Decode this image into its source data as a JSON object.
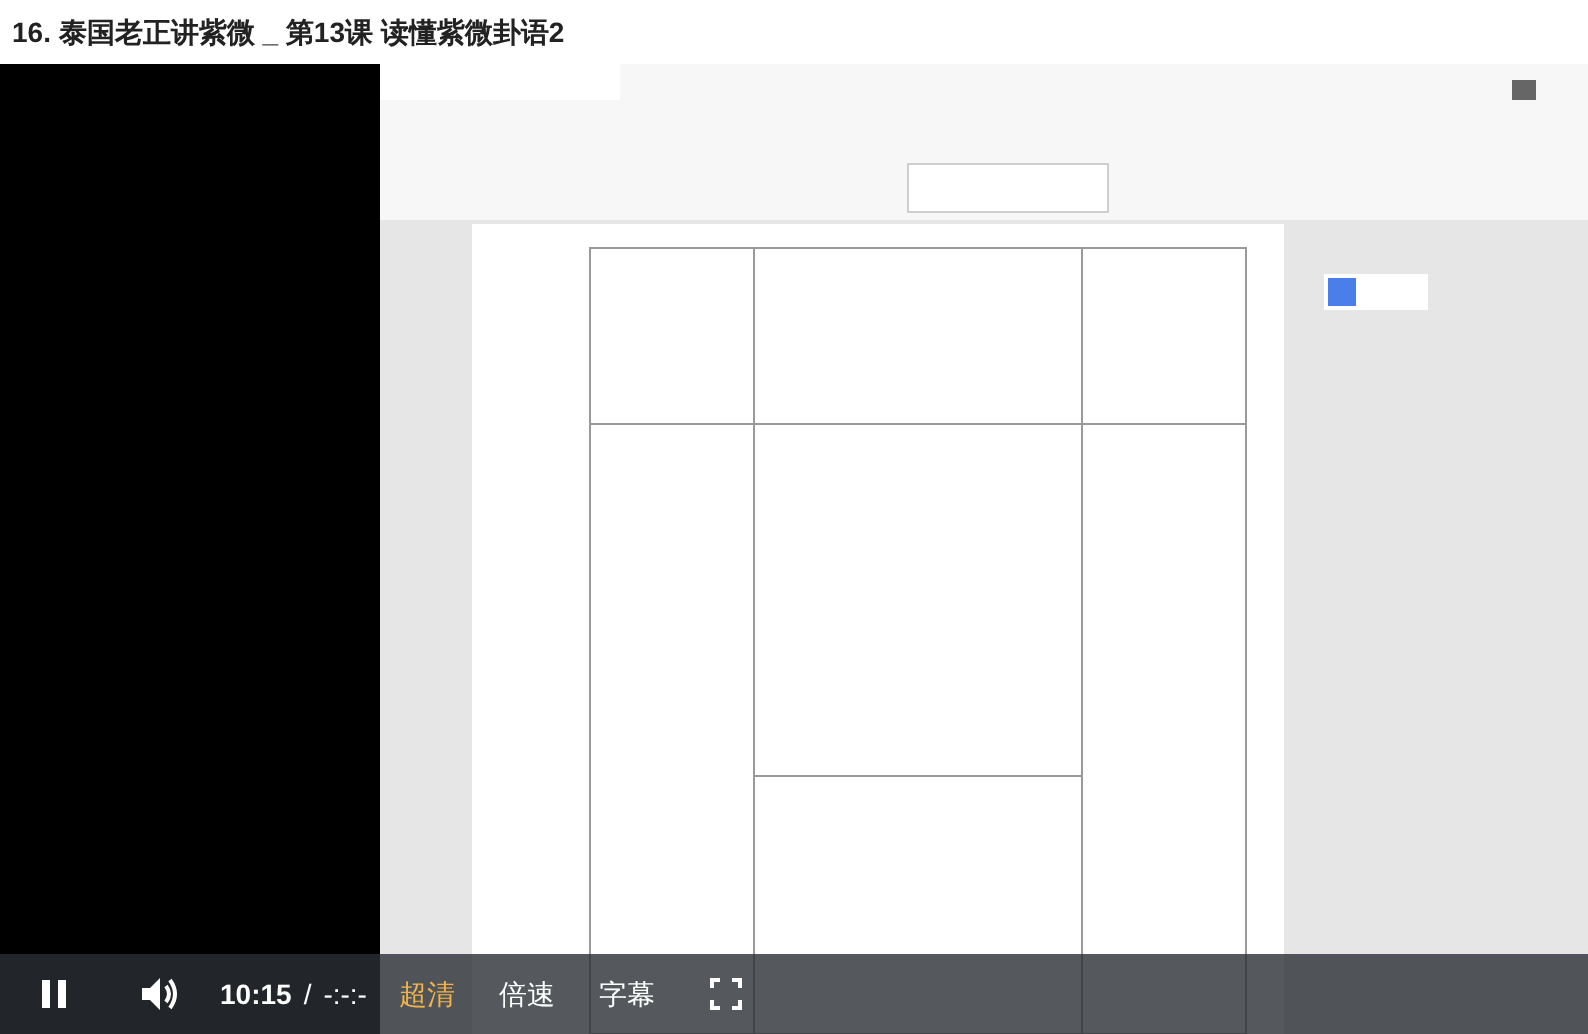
{
  "title": "16. 泰国老正讲紫微 _ 第13课 读懂紫微卦语2",
  "controls": {
    "playing": true,
    "time_current": "10:15",
    "separator": "/",
    "duration": "-:-:-",
    "quality": "超清",
    "speed": "倍速",
    "subtitles": "字幕"
  }
}
